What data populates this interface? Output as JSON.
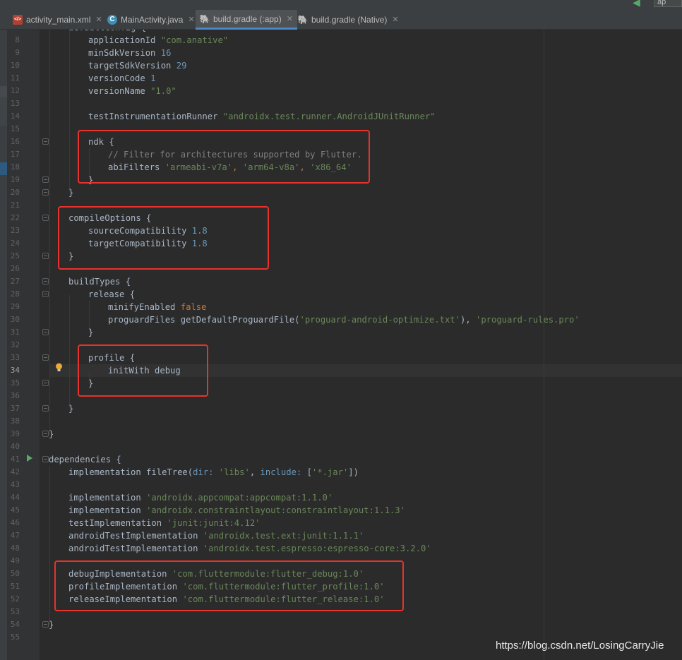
{
  "toolbar": {
    "run_config_label": "ap"
  },
  "tabs": [
    {
      "label": "activity_main.xml",
      "icon": "xml-file-icon"
    },
    {
      "label": "MainActivity.java",
      "icon": "java-class-icon",
      "icon_glyph": "C"
    },
    {
      "label": "build.gradle (:app)",
      "icon": "gradle-elephant-icon",
      "active": true
    },
    {
      "label": "build.gradle (Native)",
      "icon": "gradle-elephant-icon"
    }
  ],
  "editor": {
    "current_line": "34",
    "line_numbers": [
      "8",
      "9",
      "10",
      "11",
      "12",
      "13",
      "14",
      "15",
      "16",
      "17",
      "18",
      "19",
      "20",
      "21",
      "22",
      "23",
      "24",
      "25",
      "26",
      "27",
      "28",
      "29",
      "30",
      "31",
      "32",
      "33",
      "34",
      "35",
      "36",
      "37",
      "38",
      "39",
      "40",
      "41",
      "42",
      "43",
      "44",
      "45",
      "46",
      "47",
      "48",
      "49",
      "50",
      "51",
      "52",
      "53",
      "54",
      "55"
    ],
    "top_clipped_text": "defaultConfig {",
    "lines": {
      "l8": {
        "a": "applicationId ",
        "b": "\"com.anative\""
      },
      "l9": {
        "a": "minSdkVersion ",
        "b": "16"
      },
      "l10": {
        "a": "targetSdkVersion ",
        "b": "29"
      },
      "l11": {
        "a": "versionCode ",
        "b": "1"
      },
      "l12": {
        "a": "versionName ",
        "b": "\"1.0\""
      },
      "l14": {
        "a": "testInstrumentationRunner ",
        "b": "\"androidx.test.runner.AndroidJUnitRunner\""
      },
      "l16": {
        "a": "ndk {"
      },
      "l17": {
        "a": "// Filter for architectures supported by Flutter."
      },
      "l18": {
        "a": "abiFilters ",
        "b": "'armeabi-v7a'",
        "c": ", ",
        "d": "'arm64-v8a'",
        "e": ", ",
        "f": "'x86_64'"
      },
      "l19": {
        "a": "}"
      },
      "l20": {
        "a": "}"
      },
      "l22": {
        "a": "compileOptions {"
      },
      "l23": {
        "a": "sourceCompatibility ",
        "b": "1.8"
      },
      "l24": {
        "a": "targetCompatibility ",
        "b": "1.8"
      },
      "l25": {
        "a": "}"
      },
      "l27": {
        "a": "buildTypes {"
      },
      "l28": {
        "a": "release {"
      },
      "l29": {
        "a": "minifyEnabled ",
        "b": "false"
      },
      "l30": {
        "a": "proguardFiles getDefaultProguardFile(",
        "b": "'proguard-android-optimize.txt'",
        "c": "), ",
        "d": "'proguard-rules.pro'"
      },
      "l31": {
        "a": "}"
      },
      "l33": {
        "a": "profile {"
      },
      "l34": {
        "a": "initWith debug"
      },
      "l35": {
        "a": "}"
      },
      "l37": {
        "a": "}"
      },
      "l39": {
        "a": "}"
      },
      "l41": {
        "a": "dependencies {"
      },
      "l42": {
        "a": "implementation fileTree(",
        "b": "dir: ",
        "c": "'libs'",
        "d": ", ",
        "e": "include: ",
        "f": "[",
        "g": "'*.jar'",
        "h": "])"
      },
      "l44": {
        "a": "implementation ",
        "b": "'androidx.appcompat:appcompat:1.1.0'"
      },
      "l45": {
        "a": "implementation ",
        "b": "'androidx.constraintlayout:constraintlayout:1.1.3'"
      },
      "l46": {
        "a": "testImplementation ",
        "b": "'junit:junit:4.12'"
      },
      "l47": {
        "a": "androidTestImplementation ",
        "b": "'androidx.test.ext:junit:1.1.1'"
      },
      "l48": {
        "a": "androidTestImplementation ",
        "b": "'androidx.test.espresso:espresso-core:3.2.0'"
      },
      "l50": {
        "a": "debugImplementation ",
        "b": "'com.fluttermodule:flutter_debug:1.0'"
      },
      "l51": {
        "a": "profileImplementation ",
        "b": "'com.fluttermodule:flutter_profile:1.0'"
      },
      "l52": {
        "a": "releaseImplementation ",
        "b": "'com.fluttermodule:flutter_release:1.0'"
      },
      "l54": {
        "a": "}"
      }
    }
  },
  "annotations": {
    "highlight_color": "#e8322b"
  },
  "watermark": "https://blog.csdn.net/LosingCarryJie"
}
